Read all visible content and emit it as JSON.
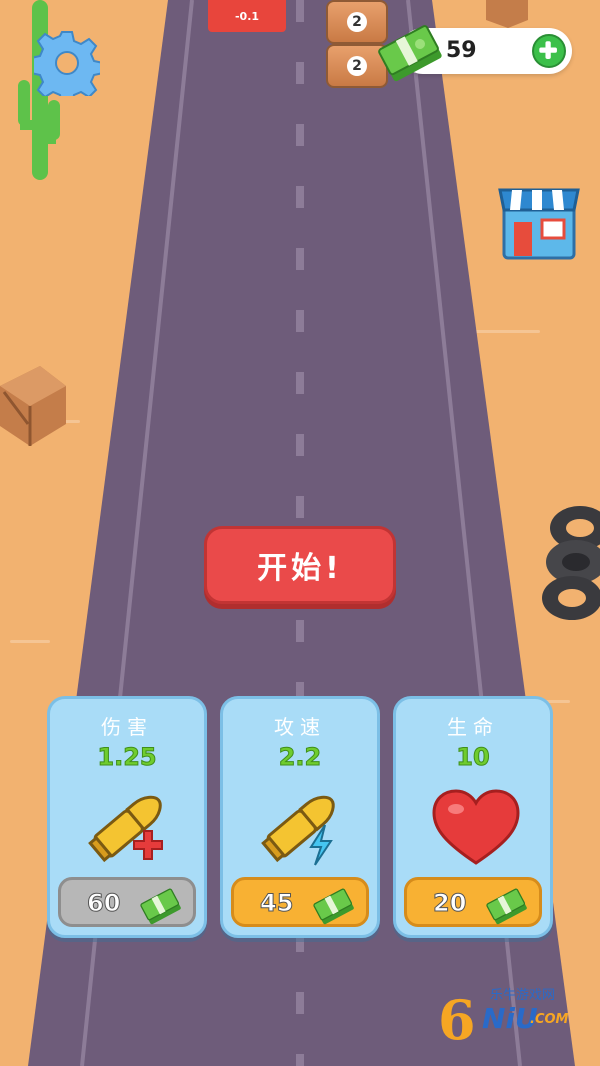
{
  "hud": {
    "money": "59",
    "icons": {
      "settings": "gear-icon",
      "add": "plus-icon",
      "currency": "cash-icon",
      "shop": "shop-icon"
    }
  },
  "track": {
    "gate_value": "-0.1",
    "barrel_values": [
      "2",
      "2"
    ]
  },
  "start_button": {
    "label": "开始!"
  },
  "upgrades": [
    {
      "title": "伤害",
      "value": "1.25",
      "price": "60",
      "icon": "bullet-plus-icon",
      "state": "disabled"
    },
    {
      "title": "攻速",
      "value": "2.2",
      "price": "45",
      "icon": "bullet-lightning-icon",
      "state": "enabled"
    },
    {
      "title": "生命",
      "value": "10",
      "price": "20",
      "icon": "heart-icon",
      "state": "enabled"
    }
  ],
  "watermark": {
    "number": "6",
    "cn": "乐牛游戏网",
    "en": "NiU",
    "domain": ".COM"
  },
  "colors": {
    "sand": "#f2b270",
    "road": "#6e5c7a",
    "start": "#ea4a4a",
    "card": "#a9dcf7",
    "buy_enabled": "#f8b133",
    "buy_disabled": "#b7b7b7"
  }
}
